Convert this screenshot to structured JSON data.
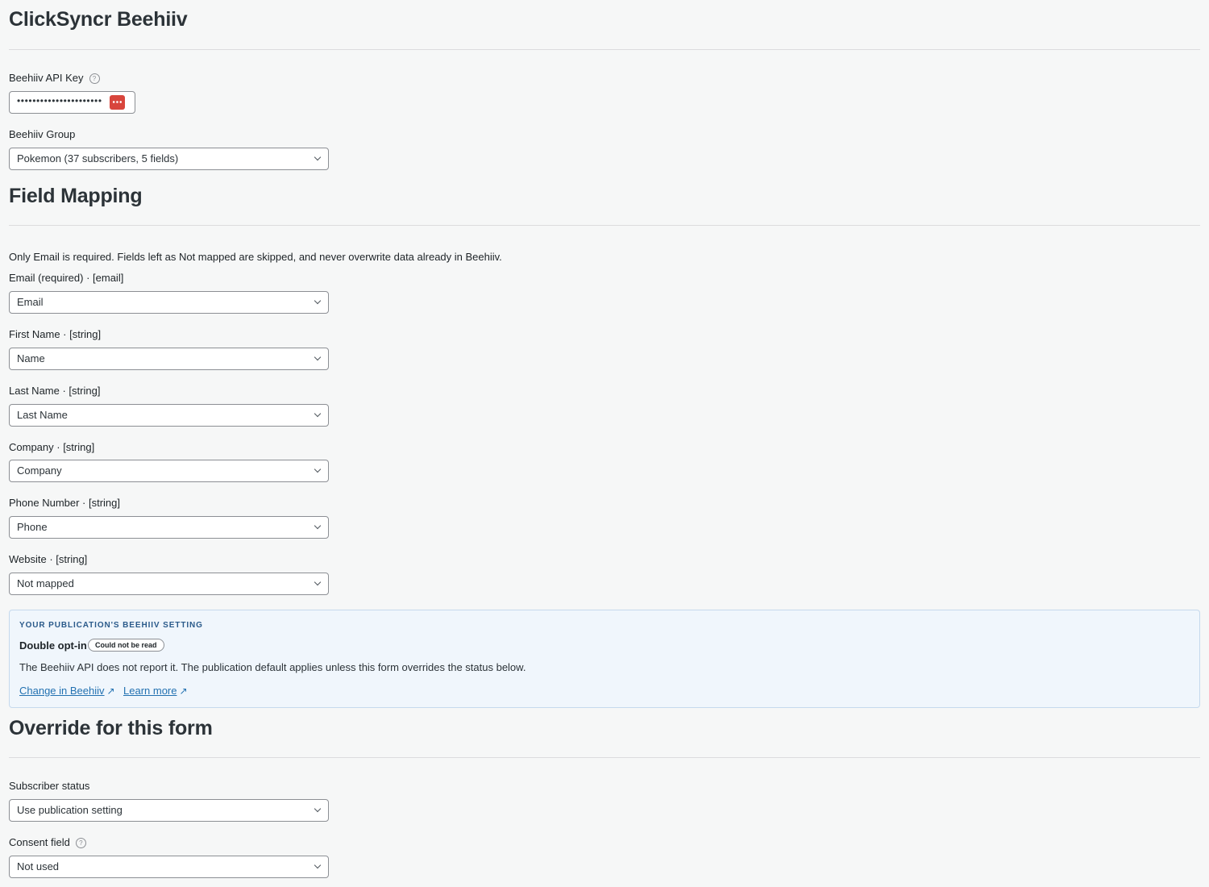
{
  "page": {
    "title": "ClickSyncr Beehiiv"
  },
  "api_key": {
    "label": "Beehiiv API Key",
    "value": "••••••••••••••••••••••"
  },
  "group": {
    "label": "Beehiiv Group",
    "selected": "Pokemon (37 subscribers, 5 fields)"
  },
  "field_mapping": {
    "heading": "Field Mapping",
    "description": "Only Email is required. Fields left as Not mapped are skipped, and never overwrite data already in Beehiiv.",
    "fields": [
      {
        "label": "Email (required) · [email]",
        "selected": "Email"
      },
      {
        "label": "First Name · [string]",
        "selected": "Name"
      },
      {
        "label": "Last Name · [string]",
        "selected": "Last Name"
      },
      {
        "label": "Company · [string]",
        "selected": "Company"
      },
      {
        "label": "Phone Number · [string]",
        "selected": "Phone"
      },
      {
        "label": "Website · [string]",
        "selected": "Not mapped"
      }
    ]
  },
  "publication_setting": {
    "eyebrow": "YOUR PUBLICATION'S BEEHIIV SETTING",
    "title": "Double opt-in",
    "badge": "Could not be read",
    "body": "The Beehiiv API does not report it. The publication default applies unless this form overrides the status below.",
    "link_change": "Change in Beehiiv",
    "link_learn": "Learn more",
    "arrow": "↗"
  },
  "override": {
    "heading": "Override for this form",
    "status_label": "Subscriber status",
    "status_selected": "Use publication setting",
    "consent_label": "Consent field",
    "consent_selected": "Not used"
  },
  "icons": {
    "help": "?",
    "help_icon": "help-circle-icon",
    "password_manager_icon": "password-manager-icon"
  },
  "colors": {
    "accent": "#2271b1",
    "panel_bg": "#f0f6fc",
    "pw_icon": "#d8453c"
  }
}
